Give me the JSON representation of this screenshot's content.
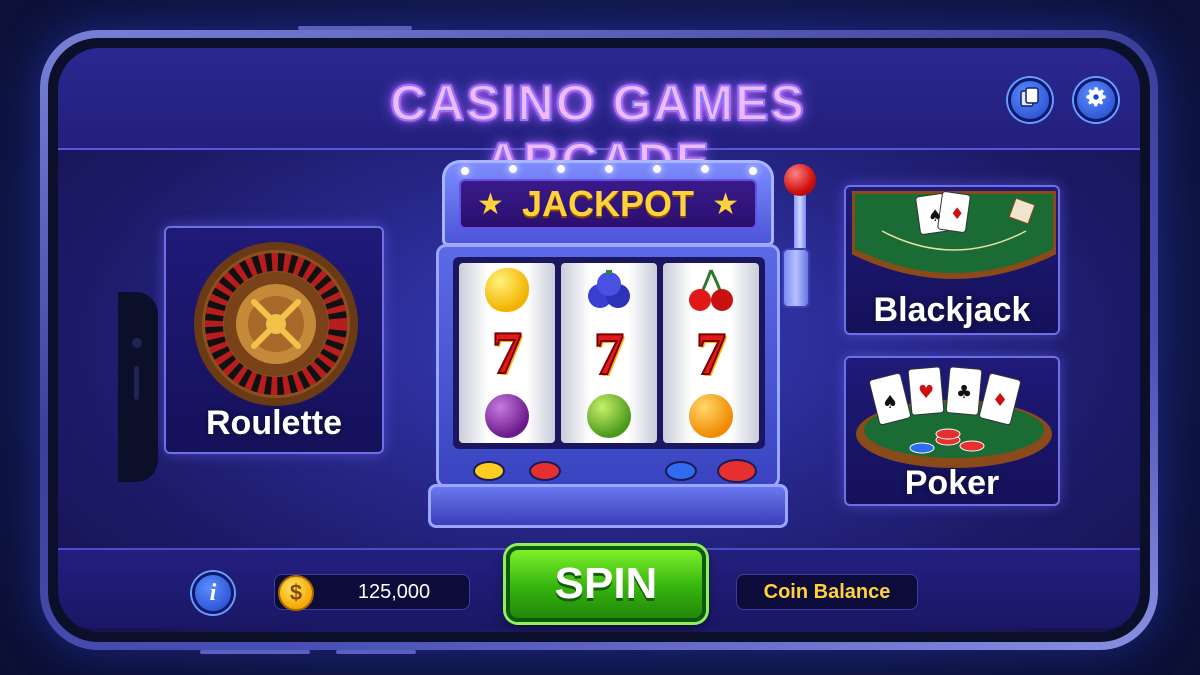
{
  "header": {
    "title": "CASINO GAMES ARCADE"
  },
  "toolbar": {
    "cards_icon": "cards-icon",
    "settings_icon": "gear-icon"
  },
  "games": {
    "roulette": {
      "label": "Roulette"
    },
    "blackjack": {
      "label": "Blackjack"
    },
    "poker": {
      "label": "Poker"
    }
  },
  "slot_machine": {
    "banner": "JACKPOT",
    "reels": [
      [
        "lemon",
        "7",
        "plum"
      ],
      [
        "blueberries",
        "7",
        "lime"
      ],
      [
        "cherries",
        "7",
        "orange"
      ]
    ],
    "button_colors": [
      "#ffcc22",
      "#e63030",
      "#2f6cf0",
      "#e63030"
    ]
  },
  "footer": {
    "info_icon": "info-icon",
    "coin_icon": "coin-icon",
    "coin_symbol": "$",
    "coin_amount": "125,000",
    "spin_label": "SPIN",
    "balance_label": "Coin Balance"
  },
  "colors": {
    "accent": "#ffd23a",
    "spin": "#35b40e",
    "neon": "#f3b8ff"
  }
}
